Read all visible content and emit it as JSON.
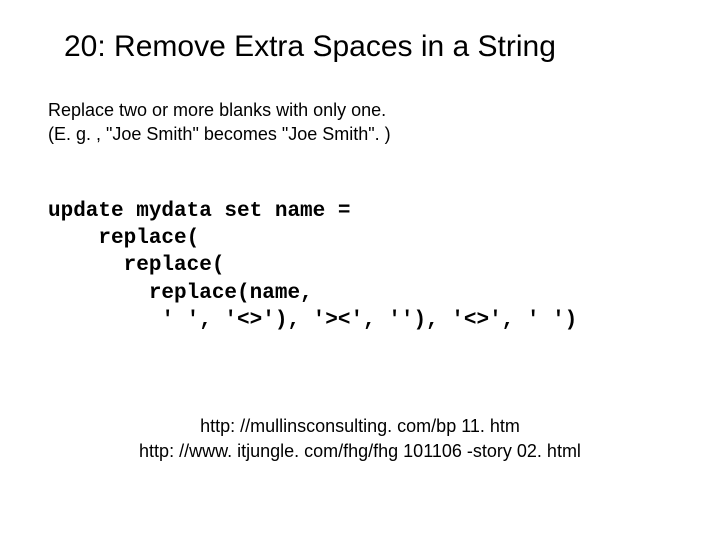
{
  "title": "20: Remove Extra Spaces in a String",
  "desc_line1": "Replace two or more blanks with only one.",
  "desc_line2": "(E. g. , \"Joe              Smith\" becomes \"Joe Smith\". )",
  "code_line1": "update mydata set name =",
  "code_line2": "    replace(",
  "code_line3": "      replace(",
  "code_line4": "        replace(name,",
  "code_line5": "         ' ', '<>'), '><', ''), '<>', ' ')",
  "ref1": "http: //mullinsconsulting. com/bp 11. htm",
  "ref2": "http: //www. itjungle. com/fhg/fhg 101106 -story 02. html"
}
